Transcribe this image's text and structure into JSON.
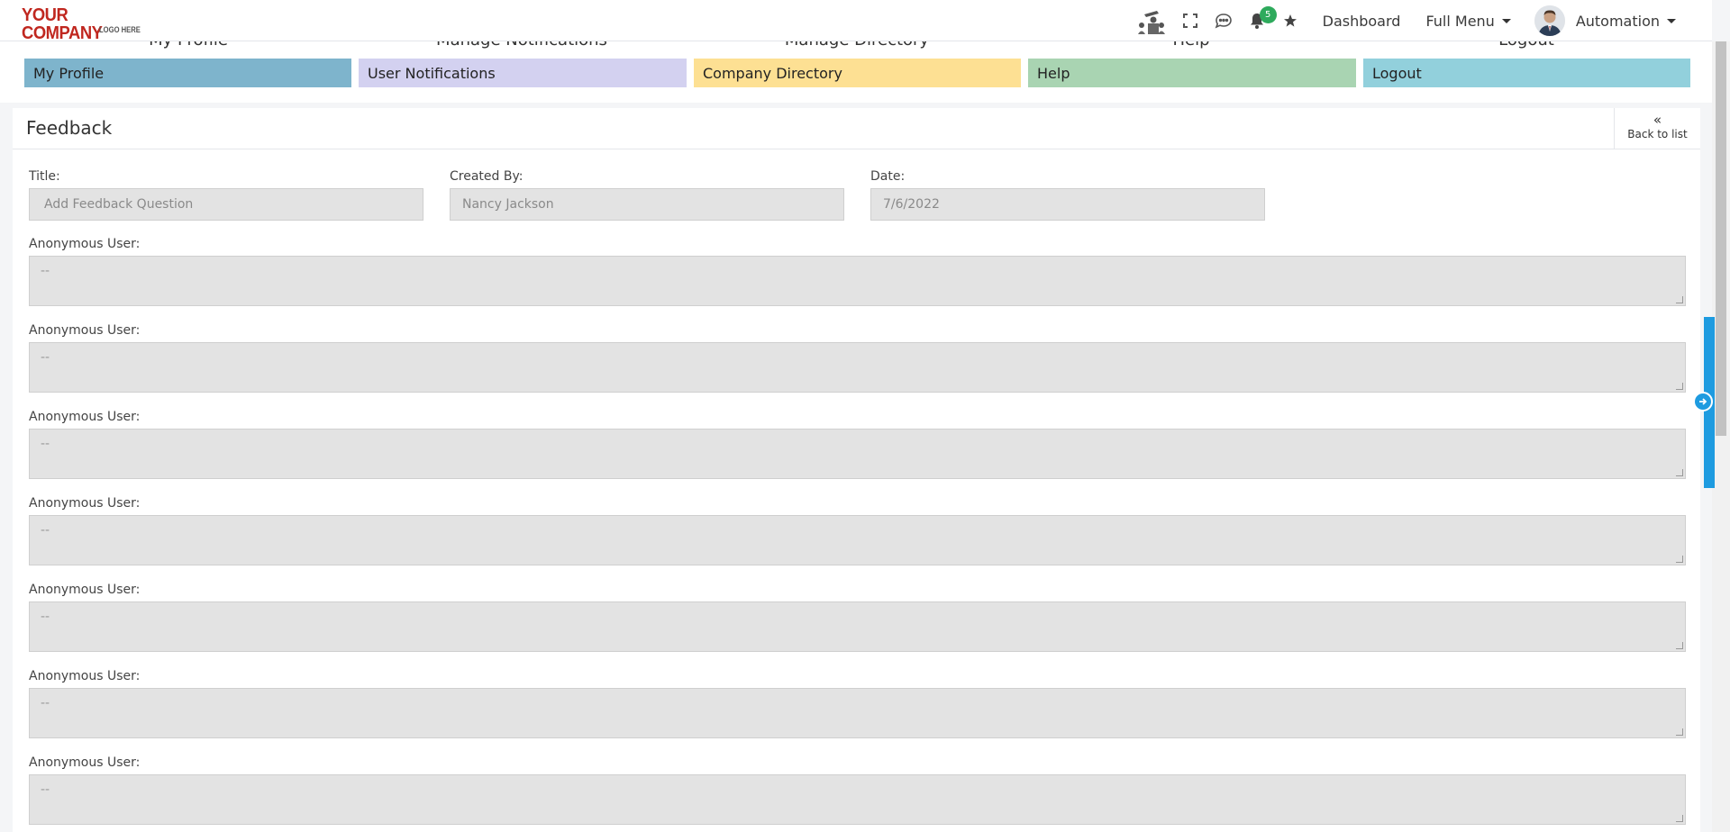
{
  "logo": {
    "line1": "YOUR COMPANY",
    "line2": "LOGO HERE"
  },
  "navbar": {
    "notification_count": "5",
    "dashboard_label": "Dashboard",
    "full_menu_label": "Full Menu",
    "user_name": "Automation"
  },
  "quick_links": [
    {
      "title": "My Profile",
      "button": "My Profile",
      "color": "#7eb4cc"
    },
    {
      "title": "Manage Notifications",
      "button": "User Notifications",
      "color": "#d3d1f0"
    },
    {
      "title": "Manage Directory",
      "button": "Company Directory",
      "color": "#fde093"
    },
    {
      "title": "Help",
      "button": "Help",
      "color": "#a9d4b2"
    },
    {
      "title": "Logout",
      "button": "Logout",
      "color": "#92d0dc"
    }
  ],
  "page": {
    "title": "Feedback",
    "back_label": "Back to list",
    "back_icon": "«"
  },
  "form": {
    "title_label": "Title:",
    "title_value": "Add Feedback Question",
    "created_by_label": "Created By:",
    "created_by_value": "Nancy Jackson",
    "date_label": "Date:",
    "date_value": "7/6/2022",
    "responses": [
      {
        "label": "Anonymous User:",
        "value": "--"
      },
      {
        "label": "Anonymous User:",
        "value": "--"
      },
      {
        "label": "Anonymous User:",
        "value": "--"
      },
      {
        "label": "Anonymous User:",
        "value": "--"
      },
      {
        "label": "Anonymous User:",
        "value": "--"
      },
      {
        "label": "Anonymous User:",
        "value": "--"
      },
      {
        "label": "Anonymous User:",
        "value": "--"
      }
    ]
  }
}
